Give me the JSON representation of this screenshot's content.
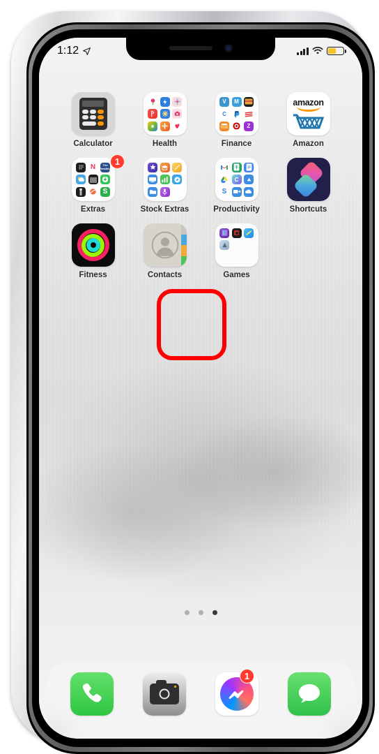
{
  "device": {
    "name": "iPhone"
  },
  "status_bar": {
    "time": "1:12",
    "location_icon": "location-arrow-icon",
    "signal_icon": "cellular-signal-icon",
    "wifi_icon": "wifi-icon",
    "battery_icon": "battery-icon",
    "battery_level_percent": 52,
    "battery_color": "#f7c325"
  },
  "home_screen": {
    "rows": [
      {
        "apps": [
          {
            "label": "Calculator",
            "type": "app",
            "icon": "calculator-icon",
            "badge": null
          },
          {
            "label": "Health",
            "type": "folder",
            "icon": "health-folder-icon",
            "badge": null
          },
          {
            "label": "Finance",
            "type": "folder",
            "icon": "finance-folder-icon",
            "badge": null
          },
          {
            "label": "Amazon",
            "type": "app",
            "icon": "amazon-icon",
            "badge": null
          }
        ]
      },
      {
        "apps": [
          {
            "label": "Extras",
            "type": "folder",
            "icon": "extras-folder-icon",
            "badge": "1"
          },
          {
            "label": "Stock Extras",
            "type": "folder",
            "icon": "stock-extras-folder-icon",
            "badge": null
          },
          {
            "label": "Productivity",
            "type": "folder",
            "icon": "productivity-folder-icon",
            "badge": null
          },
          {
            "label": "Shortcuts",
            "type": "app",
            "icon": "shortcuts-icon",
            "badge": null
          }
        ]
      },
      {
        "apps": [
          {
            "label": "Fitness",
            "type": "app",
            "icon": "fitness-icon",
            "badge": null
          },
          {
            "label": "Contacts",
            "type": "app",
            "icon": "contacts-icon",
            "badge": null,
            "highlighted": true
          },
          {
            "label": "Games",
            "type": "folder",
            "icon": "games-folder-icon",
            "badge": null
          }
        ]
      }
    ],
    "page_dots": {
      "count": 3,
      "active_index": 2
    }
  },
  "dock": {
    "apps": [
      {
        "label": "Phone",
        "icon": "phone-icon",
        "badge": null
      },
      {
        "label": "Camera",
        "icon": "camera-icon",
        "badge": null
      },
      {
        "label": "Messenger",
        "icon": "messenger-icon",
        "badge": "1"
      },
      {
        "label": "Messages",
        "icon": "messages-icon",
        "badge": null
      }
    ]
  },
  "annotation": {
    "target": "Contacts",
    "shape": "rounded-rectangle",
    "color": "#ff0000"
  },
  "folders": {
    "health": [
      {
        "name": "mini-app-1",
        "color": "#ffffff",
        "glyph": "",
        "bg": "#ffffff"
      },
      {
        "name": "mini-app-2",
        "color": "#3b82f6",
        "glyph": "",
        "bg": "#2f7de1"
      },
      {
        "name": "mini-app-3",
        "color": "#f3d9de",
        "glyph": "",
        "bg": "#f5dde1"
      },
      {
        "name": "mini-app-4",
        "color": "#e8432f",
        "glyph": "",
        "bg": "#e8432f"
      },
      {
        "name": "mini-app-5",
        "color": "#2f7de1",
        "glyph": "",
        "bg": "#2f7de1"
      },
      {
        "name": "mini-app-6",
        "color": "#f5d9de",
        "glyph": "",
        "bg": "#f5dde1"
      },
      {
        "name": "mini-app-7",
        "color": "#7bbf3f",
        "glyph": "",
        "bg": "#6fb93c"
      },
      {
        "name": "mini-app-8",
        "color": "#f08a2b",
        "glyph": "",
        "bg": "#f08a2b"
      },
      {
        "name": "mini-app-9",
        "color": "#ffffff",
        "glyph": "",
        "bg": "#ffffff"
      }
    ],
    "finance": [
      {
        "name": "venmo",
        "glyph": "V",
        "bg": "#3d95ce"
      },
      {
        "name": "mint",
        "glyph": "M",
        "bg": "#3aa0dd"
      },
      {
        "name": "wallet",
        "glyph": "",
        "bg": "#1d1d1f"
      },
      {
        "name": "credit-karma",
        "glyph": "C",
        "bg": "#ffffff"
      },
      {
        "name": "paypal",
        "glyph": "P",
        "bg": "#ffffff"
      },
      {
        "name": "cards",
        "glyph": "",
        "bg": "#ffffff"
      },
      {
        "name": "budget",
        "glyph": "",
        "bg": "#f08a2b"
      },
      {
        "name": "target",
        "glyph": "",
        "bg": "#ffffff"
      },
      {
        "name": "zelle",
        "glyph": "Z",
        "bg": "#9b30d9"
      }
    ],
    "extras": [
      {
        "name": "widgets",
        "glyph": "",
        "bg": "#1d1d1f"
      },
      {
        "name": "news",
        "glyph": "N",
        "bg": "#ffffff"
      },
      {
        "name": "reading",
        "glyph": "",
        "bg": "#2c4f87"
      },
      {
        "name": "weather",
        "glyph": "",
        "bg": "#4aa8e8"
      },
      {
        "name": "podcast",
        "glyph": "",
        "bg": "#1d1d1f"
      },
      {
        "name": "download",
        "glyph": "",
        "bg": "#34c759"
      },
      {
        "name": "flashlight",
        "glyph": "",
        "bg": "#1d1d1f"
      },
      {
        "name": "paint",
        "glyph": "",
        "bg": "#ffffff"
      },
      {
        "name": "shopping",
        "glyph": "S",
        "bg": "#2fae4e"
      }
    ],
    "stock_extras": [
      {
        "name": "itunes",
        "glyph": "",
        "bg": "#5b3fd6"
      },
      {
        "name": "podcasts",
        "glyph": "",
        "bg": "#f08a2b"
      },
      {
        "name": "notes-alt",
        "glyph": "",
        "bg": "#f5a623"
      },
      {
        "name": "tv",
        "glyph": "",
        "bg": "#3d8de0"
      },
      {
        "name": "stocks",
        "glyph": "",
        "bg": "#4cc25a"
      },
      {
        "name": "compass",
        "glyph": "",
        "bg": "#3aa6e8"
      },
      {
        "name": "files",
        "glyph": "",
        "bg": "#3d8de0"
      },
      {
        "name": "voice-memos",
        "glyph": "",
        "bg": "#9b30d9"
      }
    ],
    "productivity": [
      {
        "name": "gmail",
        "glyph": "M",
        "bg": "#ffffff"
      },
      {
        "name": "sheets",
        "glyph": "",
        "bg": "#23a566"
      },
      {
        "name": "docs",
        "glyph": "",
        "bg": "#4285f4"
      },
      {
        "name": "drive",
        "glyph": "",
        "bg": "#ffffff"
      },
      {
        "name": "chrome",
        "glyph": "C",
        "bg": "#4bc0c8"
      },
      {
        "name": "cloud-arrow",
        "glyph": "",
        "bg": "#3d8de0"
      },
      {
        "name": "skype",
        "glyph": "S",
        "bg": "#ffffff"
      },
      {
        "name": "meet",
        "glyph": "",
        "bg": "#3d8de0"
      },
      {
        "name": "onedrive",
        "glyph": "",
        "bg": "#3d8de0"
      }
    ],
    "games": [
      {
        "name": "game-1",
        "glyph": "",
        "bg": "#7b4fd6"
      },
      {
        "name": "game-2",
        "glyph": "",
        "bg": "#1d1d1f"
      },
      {
        "name": "game-3",
        "glyph": "",
        "bg": "#3aa6e8"
      },
      {
        "name": "game-4",
        "glyph": "",
        "bg": "#c9d6e8"
      }
    ]
  }
}
